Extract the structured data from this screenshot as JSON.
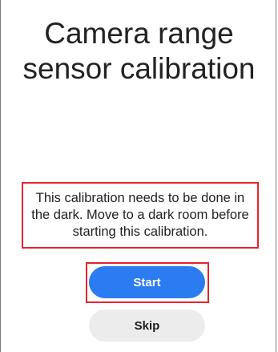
{
  "screen": {
    "title_line1": "Camera range",
    "title_line2": "sensor calibration",
    "notice_text": "This calibration needs to be done in the dark. Move to a dark room before starting this calibration."
  },
  "actions": {
    "start_label": "Start",
    "skip_label": "Skip"
  },
  "colors": {
    "primary": "#2b7bf1",
    "secondary_button": "#ececec",
    "highlight": "#e8232e"
  }
}
